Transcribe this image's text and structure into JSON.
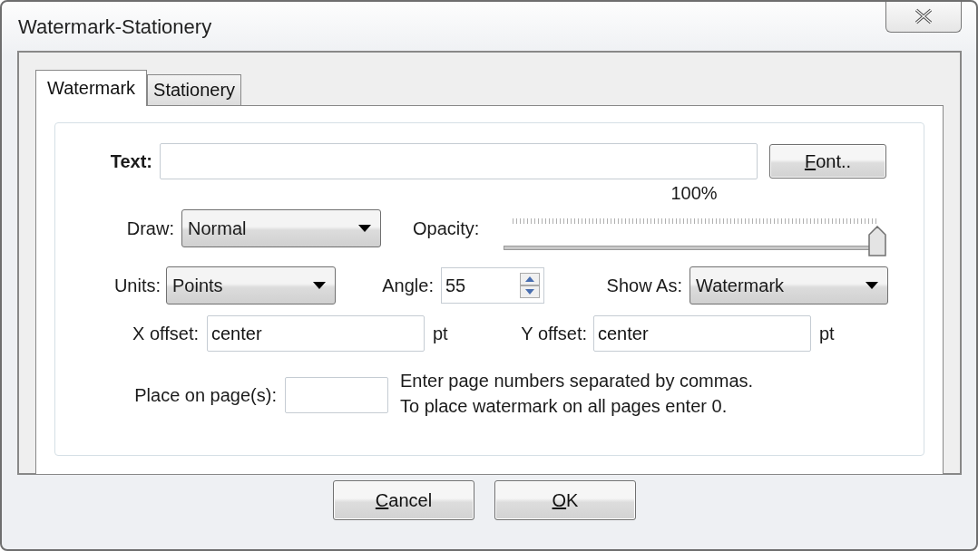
{
  "window": {
    "title": "Watermark-Stationery"
  },
  "tabs": [
    {
      "label": "Watermark",
      "selected": true
    },
    {
      "label": "Stationery",
      "selected": false
    }
  ],
  "text_field": {
    "label": "Text:"
  },
  "font_button": {
    "label": "Font..",
    "mnemonic": true
  },
  "draw": {
    "label": "Draw:",
    "value": "Normal"
  },
  "opacity": {
    "label": "Opacity:",
    "reading": "100%",
    "level": 1
  },
  "units": {
    "label": "Units:",
    "value": "Points"
  },
  "angle": {
    "label": "Angle:",
    "value": "55"
  },
  "show_as": {
    "label": "Show As:",
    "value": "Watermark"
  },
  "x_offset": {
    "label": "X offset:",
    "value": "center",
    "unit": "pt"
  },
  "y_offset": {
    "label": "Y offset:",
    "value": "center",
    "unit": "pt"
  },
  "place_on_pages": {
    "label": "Place on page(s):",
    "hint": [
      "Enter page numbers separated by commas.",
      "To place watermark on all pages enter 0."
    ]
  },
  "buttons": [
    {
      "label": "Cancel",
      "mnemonic": true
    },
    {
      "label": "OK",
      "mnemonic": true
    }
  ]
}
